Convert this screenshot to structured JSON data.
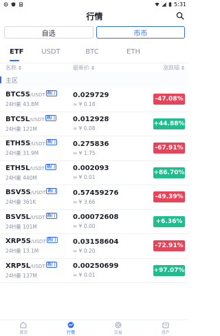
{
  "status_bar": {
    "time": "5:31"
  },
  "header": {
    "title": "行情"
  },
  "segments": [
    {
      "label": "自选",
      "active": false
    },
    {
      "label": "币币",
      "active": true
    }
  ],
  "tabs": [
    {
      "label": "ETF",
      "active": true
    },
    {
      "label": "USDT",
      "active": false
    },
    {
      "label": "BTC",
      "active": false
    },
    {
      "label": "ETH",
      "active": false
    }
  ],
  "columns": {
    "name": "名称",
    "price": "最新价",
    "change": "涨跌幅"
  },
  "section_label": "主区",
  "hot_label": "热门",
  "rows": [
    {
      "base": "BTC5S",
      "quote": "/USDT",
      "hot": true,
      "vol": "24H量 43.8M",
      "price": "0.029729",
      "cny": "≈ ¥ 0.18",
      "change": "-47.08%",
      "dir": "down"
    },
    {
      "base": "BTC5L",
      "quote": "/USDT",
      "hot": true,
      "vol": "24H量 121M",
      "price": "0.012928",
      "cny": "≈ ¥ 0.08",
      "change": "+44.88%",
      "dir": "up"
    },
    {
      "base": "ETH5S",
      "quote": "/USDT",
      "hot": true,
      "vol": "24H量 31.9M",
      "price": "0.275836",
      "cny": "≈ ¥ 1.75",
      "change": "-67.91%",
      "dir": "down"
    },
    {
      "base": "ETH5L",
      "quote": "/USDT",
      "hot": true,
      "vol": "24H量 440M",
      "price": "0.002093",
      "cny": "≈ ¥ 0.01",
      "change": "+86.70%",
      "dir": "up"
    },
    {
      "base": "BSV5S",
      "quote": "/USDT",
      "hot": true,
      "vol": "24H量 361K",
      "price": "0.57459276",
      "cny": "≈ ¥ 3.66",
      "change": "-49.39%",
      "dir": "down"
    },
    {
      "base": "BSV5L",
      "quote": "/USDT",
      "hot": true,
      "vol": "24H量 101M",
      "price": "0.00072608",
      "cny": "≈ ¥ 0.00",
      "change": "+6.36%",
      "dir": "up"
    },
    {
      "base": "XRP5S",
      "quote": "/USDT",
      "hot": true,
      "vol": "24H量 13.1M",
      "price": "0.03158604",
      "cny": "≈ ¥ 0.20",
      "change": "-72.91%",
      "dir": "down"
    },
    {
      "base": "XRP5L",
      "quote": "/USDT",
      "hot": true,
      "vol": "24H量 137M",
      "price": "0.00250699",
      "cny": "≈ ¥ 0.01",
      "change": "+97.07%",
      "dir": "up"
    }
  ],
  "bottom_nav": [
    {
      "label": "首页",
      "icon": "home-icon",
      "active": false
    },
    {
      "label": "行情",
      "icon": "market-icon",
      "active": true
    },
    {
      "label": "交易",
      "icon": "trade-icon",
      "active": false
    },
    {
      "label": "资产",
      "icon": "wallet-icon",
      "active": false
    }
  ],
  "colors": {
    "accent": "#2f6bff",
    "up": "#1ebd8e",
    "down": "#e9435a"
  }
}
